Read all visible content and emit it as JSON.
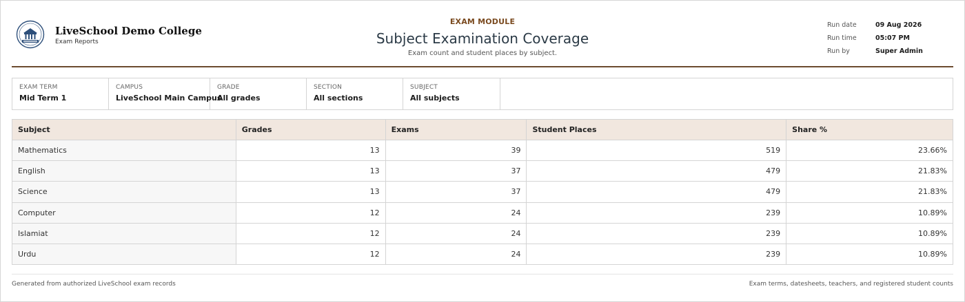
{
  "header": {
    "org_name": "LiveSchool Demo College",
    "org_sub": "Exam Reports",
    "module": "EXAM MODULE",
    "title": "Subject Examination Coverage",
    "subtitle": "Exam count and student places by subject.",
    "meta": [
      {
        "label": "Run date",
        "value": "09 Aug 2026"
      },
      {
        "label": "Run time",
        "value": "05:07 PM"
      },
      {
        "label": "Run by",
        "value": "Super Admin"
      }
    ]
  },
  "filters": [
    {
      "label": "EXAM TERM",
      "value": "Mid Term 1"
    },
    {
      "label": "CAMPUS",
      "value": "LiveSchool Main Campus"
    },
    {
      "label": "GRADE",
      "value": "All grades"
    },
    {
      "label": "SECTION",
      "value": "All sections"
    },
    {
      "label": "SUBJECT",
      "value": "All subjects"
    }
  ],
  "table": {
    "headers": [
      "Subject",
      "Grades",
      "Exams",
      "Student Places",
      "Share %"
    ],
    "rows": [
      [
        "Mathematics",
        "13",
        "39",
        "519",
        "23.66%"
      ],
      [
        "English",
        "13",
        "37",
        "479",
        "21.83%"
      ],
      [
        "Science",
        "13",
        "37",
        "479",
        "21.83%"
      ],
      [
        "Computer",
        "12",
        "24",
        "239",
        "10.89%"
      ],
      [
        "Islamiat",
        "12",
        "24",
        "239",
        "10.89%"
      ],
      [
        "Urdu",
        "12",
        "24",
        "239",
        "10.89%"
      ]
    ]
  },
  "footer": {
    "left": "Generated from authorized LiveSchool exam records",
    "right": "Exam terms, datesheets, teachers, and registered student counts"
  },
  "colors": {
    "accent": "#7a4a1f",
    "rule": "#6b4a2e",
    "header_bg": "#f1e7df",
    "title": "#2b3a46"
  },
  "icons": {
    "logo": "college-crest-logo"
  }
}
